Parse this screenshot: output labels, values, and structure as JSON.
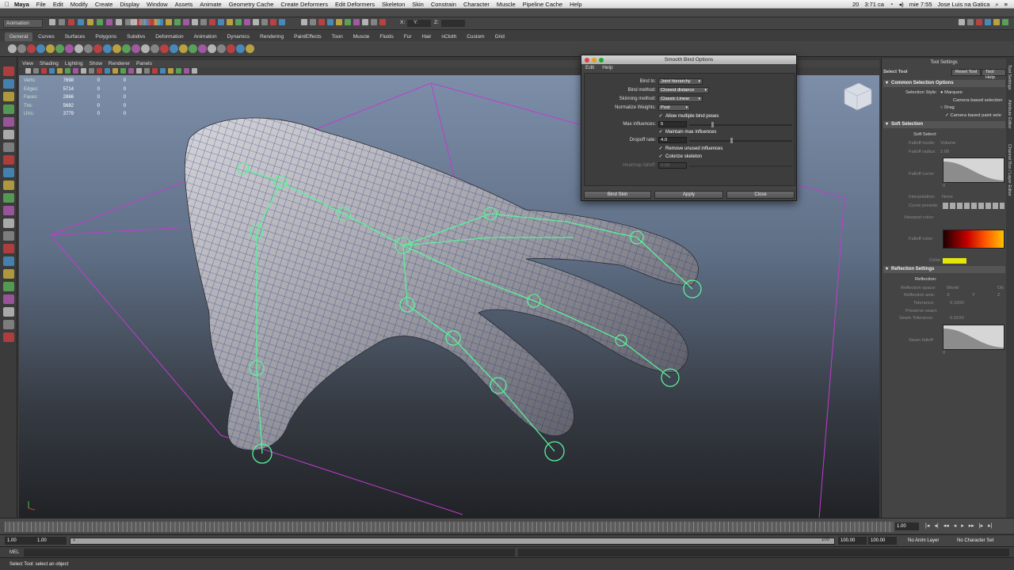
{
  "mac_menubar": {
    "app_name": "Maya",
    "items": [
      "File",
      "Edit",
      "Modify",
      "Create",
      "Display",
      "Window",
      "Assets",
      "Animate",
      "Geometry Cache",
      "Create Deformers",
      "Edit Deformers",
      "Skeleton",
      "Skin",
      "Constrain",
      "Character",
      "Muscle",
      "Pipeline Cache",
      "Help"
    ],
    "status": {
      "battery": "3:71 ca",
      "clock": "mie 7:55",
      "user": "Jose Luis  na Gatica",
      "counter": "20"
    }
  },
  "status_line": {
    "mode": "Animation",
    "xyz_labels": [
      "X:",
      "Y:",
      "Z:"
    ]
  },
  "shelf": {
    "tabs": [
      "General",
      "Curves",
      "Surfaces",
      "Polygons",
      "Subdivs",
      "Deformation",
      "Animation",
      "Dynamics",
      "Rendering",
      "PaintEffects",
      "Toon",
      "Muscle",
      "Fluids",
      "Fur",
      "Hair",
      "nCloth",
      "Custom",
      "Grid"
    ],
    "active_tab": "General"
  },
  "viewport": {
    "menu": [
      "View",
      "Shading",
      "Lighting",
      "Show",
      "Renderer",
      "Panels"
    ],
    "hud": [
      {
        "label": "Verts:",
        "v1": "7698",
        "v2": "0",
        "v3": "0"
      },
      {
        "label": "Edges:",
        "v1": "5714",
        "v2": "0",
        "v3": "0"
      },
      {
        "label": "Faces:",
        "v1": "2866",
        "v2": "0",
        "v3": "0"
      },
      {
        "label": "Tris:",
        "v1": "5682",
        "v2": "0",
        "v3": "0"
      },
      {
        "label": "UVs:",
        "v1": "3779",
        "v2": "0",
        "v3": "0"
      }
    ]
  },
  "dialog": {
    "title": "Smooth Bind Options",
    "menu": [
      "Edit",
      "Help"
    ],
    "bind_to_label": "Bind to:",
    "bind_to_value": "Joint hierarchy",
    "bind_method_label": "Bind method:",
    "bind_method_value": "Closest distance",
    "skinning_label": "Skinning method:",
    "skinning_value": "Classic Linear",
    "normalize_label": "Normalize Weights:",
    "normalize_value": "Post",
    "allow_multiple": "Allow multiple bind poses",
    "max_influences_label": "Max influences:",
    "max_influences_value": "5",
    "maintain_max": "Maintain max influences",
    "dropoff_label": "Dropoff rate:",
    "dropoff_value": "4.0",
    "remove_unused": "Remove unused influences",
    "colorize": "Colorize skeleton",
    "heatmap_label": "Heatmap falloff:",
    "heatmap_value": "0.68",
    "buttons": {
      "bind": "Bind Skin",
      "apply": "Apply",
      "close": "Close"
    }
  },
  "tool_settings": {
    "panel_title": "Tool Settings",
    "tool_name": "Select Tool",
    "reset_button": "Reset Tool",
    "help_button": "Tool Help",
    "common_header": "Common Selection Options",
    "selection_style_label": "Selection Style:",
    "marquee": "Marquee",
    "camera_based_selection": "Camera based selection",
    "drag": "Drag",
    "camera_based_paint": "Camera based paint sele",
    "soft_header": "Soft Selection",
    "soft_select_label": "Soft Select:",
    "falloff_mode_label": "Falloff mode:",
    "falloff_mode_value": "Volume",
    "falloff_radius_label": "Falloff radius:",
    "falloff_radius_value": "2.00",
    "falloff_curve_label": "Falloff curve:",
    "interp_label": "Interpolation:",
    "interp_value": "None",
    "curve_presets_label": "Curve presets:",
    "viewport_color_label": "Viewport color:",
    "falloff_color_label": "Falloff color:",
    "color_label": "Color:",
    "reflection_header": "Reflection Settings",
    "reflection_label": "Reflection:",
    "reflection_space_label": "Reflection space:",
    "reflection_space_value": "World",
    "reflection_space_value2": "Ob",
    "reflection_axis_label": "Reflection axis:",
    "axis_x": "X",
    "axis_y": "Y",
    "axis_z": "Z",
    "tolerance_label": "Tolerance:",
    "tolerance_value": "0.1000",
    "preserve_seam_label": "Preserve seam:",
    "seam_tolerance_label": "Seam Tolerance:",
    "seam_tolerance_value": "0.0100",
    "seam_falloff_label": "Seam falloff:",
    "curve_zero": "0",
    "side_tabs": [
      "Tool Settings",
      "Attribute Editor",
      "Channel Box / Layer Editor"
    ]
  },
  "timeline": {
    "current_frame": "1.00"
  },
  "range": {
    "start": "1.00",
    "start2": "1.00",
    "slider_start": "1",
    "slider_end": "100",
    "end": "100.00",
    "end2": "100.00",
    "anim_layer": "No Anim Layer",
    "char_set": "No Character Set"
  },
  "mel": {
    "label": "MEL"
  },
  "help_line": {
    "text": "Select Tool: select an object"
  },
  "colors": {
    "joint": "#59f29a",
    "bbox": "#c23bd0",
    "wire": "#20268a",
    "accent": "#e3e50b"
  }
}
